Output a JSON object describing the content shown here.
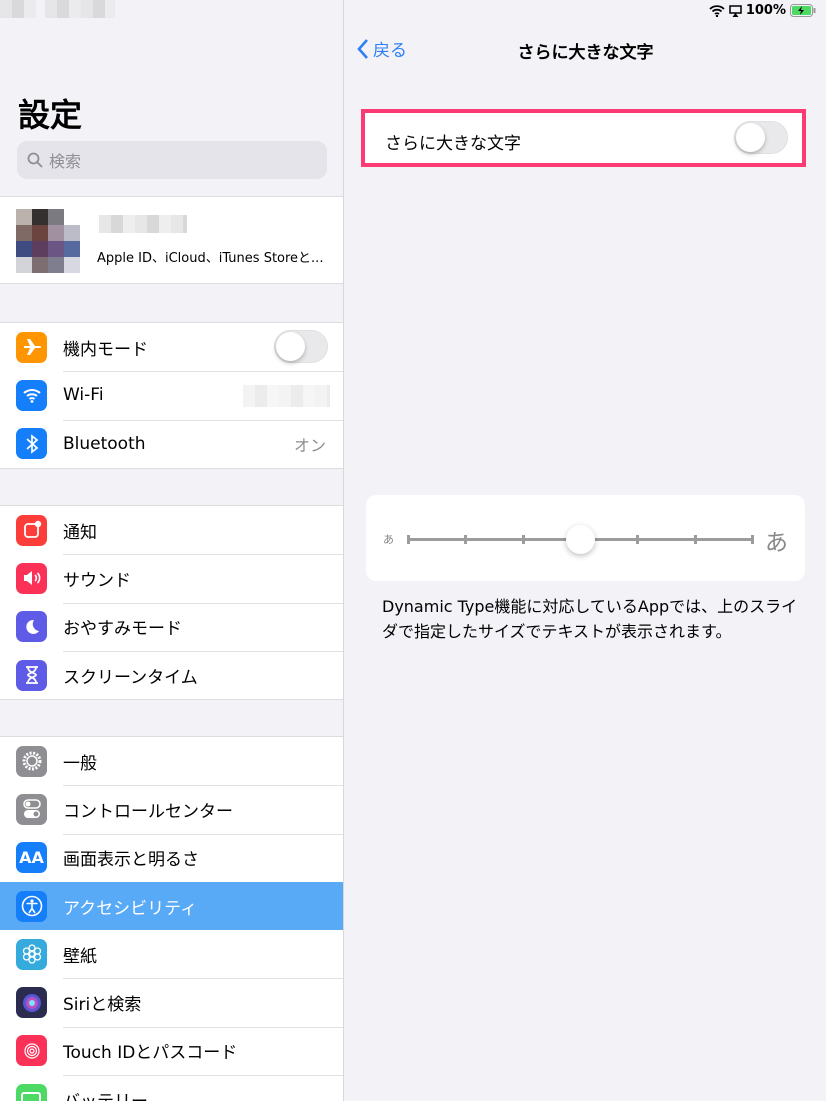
{
  "status_bar": {
    "battery": "100%",
    "colors": {
      "battery": "#4cd964"
    }
  },
  "sidebar": {
    "title": "設定",
    "search_placeholder": "検索",
    "profile": {
      "subtitle": "Apple ID、iCloud、iTunes Storeと..."
    },
    "groups": [
      [
        {
          "label": "機内モード",
          "icon": "airplane-icon",
          "color": "#ff9500",
          "accessory": "toggle",
          "toggle_on": false
        },
        {
          "label": "Wi-Fi",
          "icon": "wifi-icon",
          "color": "#147efb"
        },
        {
          "label": "Bluetooth",
          "icon": "bluetooth-icon",
          "color": "#147efb",
          "value": "オン"
        }
      ],
      [
        {
          "label": "通知",
          "icon": "notifications-icon",
          "color": "#fc3d39"
        },
        {
          "label": "サウンド",
          "icon": "sound-icon",
          "color": "#fc3158"
        },
        {
          "label": "おやすみモード",
          "icon": "moon-icon",
          "color": "#5e5ce6"
        },
        {
          "label": "スクリーンタイム",
          "icon": "hourglass-icon",
          "color": "#5e5ce6"
        }
      ],
      [
        {
          "label": "一般",
          "icon": "gear-icon",
          "color": "#8e8e93"
        },
        {
          "label": "コントロールセンター",
          "icon": "switches-icon",
          "color": "#8e8e93"
        },
        {
          "label": "画面表示と明るさ",
          "icon": "text-size-icon",
          "color": "#147efb",
          "glyph": "AA"
        },
        {
          "label": "アクセシビリティ",
          "icon": "accessibility-icon",
          "color": "#147efb",
          "selected": true
        },
        {
          "label": "壁紙",
          "icon": "flower-icon",
          "color": "#35aadc"
        },
        {
          "label": "Siriと検索",
          "icon": "siri-icon",
          "color": "#2b2b4f"
        },
        {
          "label": "Touch IDとパスコード",
          "icon": "fingerprint-icon",
          "color": "#fc3158"
        },
        {
          "label": "バッテリー",
          "icon": "battery-icon",
          "color": "#4cd964"
        }
      ]
    ],
    "colors": {
      "selected": "#58a9f6"
    }
  },
  "detail": {
    "back_label": "戻る",
    "title": "さらに大きな文字",
    "toggle_label": "さらに大きな文字",
    "toggle_on": false,
    "highlight_color": "#fc3a73",
    "slider": {
      "min_label": "あ",
      "max_label": "あ",
      "steps": 7,
      "value_index": 3,
      "value_fraction": 0.5
    },
    "description": "Dynamic Type機能に対応しているAppでは、上のスライダで指定したサイズでテキストが表示されます。"
  }
}
